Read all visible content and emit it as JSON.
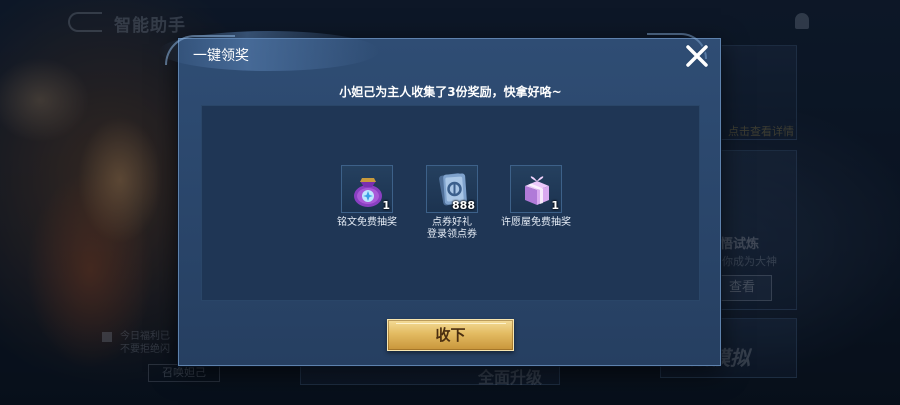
{
  "background": {
    "top_title": "智能助手",
    "view_details": "点击查看详情",
    "trial_title": "悟试炼",
    "trial_subtitle": "你成为大神",
    "view_button": "查看",
    "mode_text": "战模拟",
    "notice_line1": "今日福利已",
    "notice_line2": "不要拒绝闪",
    "summon_button": "召唤妲己",
    "season_text": "全面升级"
  },
  "modal": {
    "title": "一键领奖",
    "message": "小妲己为主人收集了3份奖励，快拿好咯~",
    "rewards": [
      {
        "label_line1": "铭文免费抽奖",
        "label_line2": "",
        "count": "1",
        "icon": "rune-bag-icon"
      },
      {
        "label_line1": "点券好礼",
        "label_line2": "登录领点券",
        "count": "888",
        "icon": "coupon-card-icon"
      },
      {
        "label_line1": "许愿屋免费抽奖",
        "label_line2": "",
        "count": "1",
        "icon": "gift-box-icon"
      }
    ],
    "collect_button": "收下"
  },
  "colors": {
    "modal_bg": "#2a466b",
    "panel_bg": "#1f3655",
    "button_gold": "#e3bb62",
    "button_text": "#4a2e10"
  }
}
